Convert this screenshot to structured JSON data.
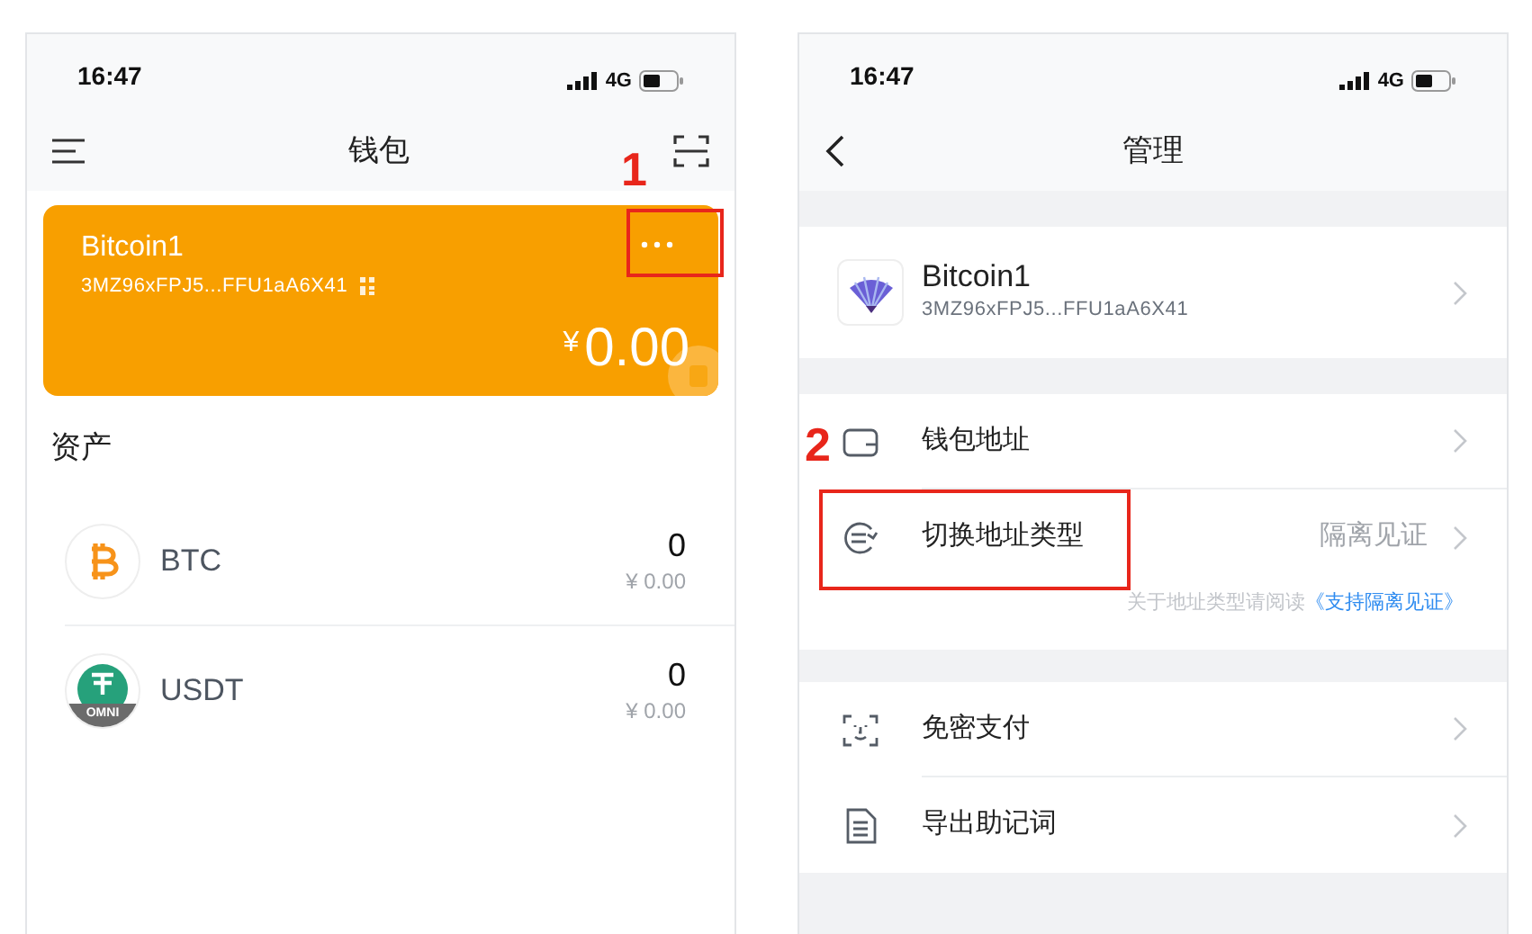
{
  "wallet_screen": {
    "status_bar": {
      "time": "16:47",
      "network": "4G"
    },
    "title": "钱包",
    "card": {
      "name": "Bitcoin1",
      "address": "3MZ96xFPJ5...FFU1aA6X41",
      "currency": "¥",
      "amount": "0.00"
    },
    "section_title": "资产",
    "assets": [
      {
        "kind": "btc",
        "symbol": "BTC",
        "amount": "0",
        "value": "¥ 0.00"
      },
      {
        "kind": "usdt",
        "symbol": "USDT",
        "badge": "OMNI",
        "amount": "0",
        "value": "¥ 0.00"
      }
    ]
  },
  "manage_screen": {
    "status_bar": {
      "time": "16:47",
      "network": "4G"
    },
    "title": "管理",
    "wallet": {
      "name": "Bitcoin1",
      "address": "3MZ96xFPJ5...FFU1aA6X41"
    },
    "address_group": [
      {
        "kind": "wallet",
        "label": "钱包地址"
      },
      {
        "kind": "switch",
        "label": "切换地址类型",
        "value": "隔离见证"
      }
    ],
    "note": {
      "text": "关于地址类型请阅读",
      "link": "《支持隔离见证》"
    },
    "security_group": [
      {
        "kind": "face",
        "label": "免密支付"
      },
      {
        "kind": "document",
        "label": "导出助记词"
      }
    ]
  },
  "annotations": [
    {
      "label": "1"
    },
    {
      "label": "2"
    }
  ]
}
